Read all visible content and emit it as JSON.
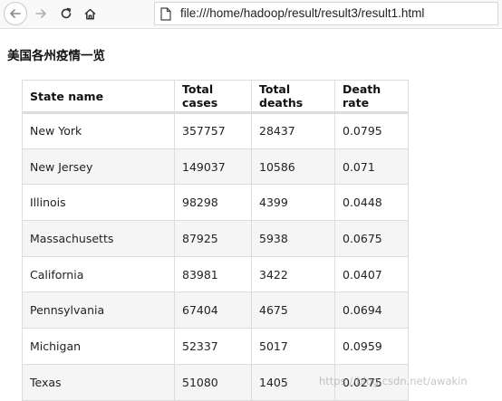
{
  "browser": {
    "url": "file:///home/hadoop/result/result3/result1.html"
  },
  "page": {
    "title": "美国各州疫情一览"
  },
  "table": {
    "headers": [
      "State name",
      "Total cases",
      "Total deaths",
      "Death rate"
    ],
    "rows": [
      [
        "New York",
        "357757",
        "28437",
        "0.0795"
      ],
      [
        "New Jersey",
        "149037",
        "10586",
        "0.071"
      ],
      [
        "Illinois",
        "98298",
        "4399",
        "0.0448"
      ],
      [
        "Massachusetts",
        "87925",
        "5938",
        "0.0675"
      ],
      [
        "California",
        "83981",
        "3422",
        "0.0407"
      ],
      [
        "Pennsylvania",
        "67404",
        "4675",
        "0.0694"
      ],
      [
        "Michigan",
        "52337",
        "5017",
        "0.0959"
      ],
      [
        "Texas",
        "51080",
        "1405",
        "0.0275"
      ]
    ]
  },
  "watermark": "https://blog.csdn.net/awakin",
  "colors": {
    "toolbar_bg": "#f9f9fa",
    "row_stripe": "#f5f5f5",
    "border": "#dddddd"
  }
}
